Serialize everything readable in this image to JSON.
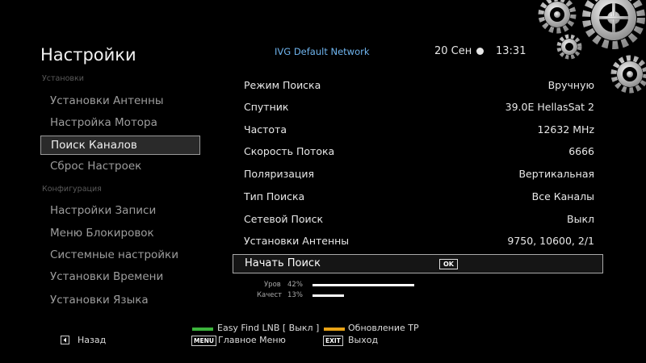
{
  "header": {
    "title": "Настройки",
    "network": "IVG Default Network",
    "date": "20 Сен",
    "time": "13:31"
  },
  "sidebar": {
    "section1": "Установки",
    "section2": "Конфигурация",
    "items": [
      {
        "label": "Установки Антенны"
      },
      {
        "label": "Настройка Мотора"
      },
      {
        "label": "Поиск Каналов"
      },
      {
        "label": "Сброс Настроек"
      },
      {
        "label": "Настройки Записи"
      },
      {
        "label": "Меню Блокировок"
      },
      {
        "label": "Системные настройки"
      },
      {
        "label": "Установки Времени"
      },
      {
        "label": "Установки Языка"
      }
    ],
    "selected": "Поиск Каналов"
  },
  "settings": [
    {
      "label": "Режим Поиска",
      "value": "Вручную"
    },
    {
      "label": "Спутник",
      "value": "39.0E HellasSat 2"
    },
    {
      "label": "Частота",
      "value": "12632 MHz"
    },
    {
      "label": "Скорость Потока",
      "value": "6666"
    },
    {
      "label": "Поляризация",
      "value": "Вертикальная"
    },
    {
      "label": "Тип Поиска",
      "value": "Все Каналы"
    },
    {
      "label": "Сетевой Поиск",
      "value": "Выкл"
    },
    {
      "label": "Установки Антенны",
      "value": "9750, 10600, 2/1"
    }
  ],
  "start": {
    "label": "Начать Поиск",
    "ok": "OK"
  },
  "signal": {
    "level_label": "Уров",
    "level_value": "42%",
    "level": 0.42,
    "quality_label": "Качест",
    "quality_value": "13%",
    "quality": 0.13
  },
  "footer": {
    "back": "Назад",
    "green": "Easy Find LNB [ Выкл ]",
    "yellow": "Обновление TP",
    "menu_key": "MENU",
    "menu": "Главное Меню",
    "exit_key": "EXIT",
    "exit": "Выход"
  },
  "colors": {
    "green_key": "#3cb43c",
    "yellow_key": "#e8a317",
    "network_text": "#6fb4ee"
  }
}
